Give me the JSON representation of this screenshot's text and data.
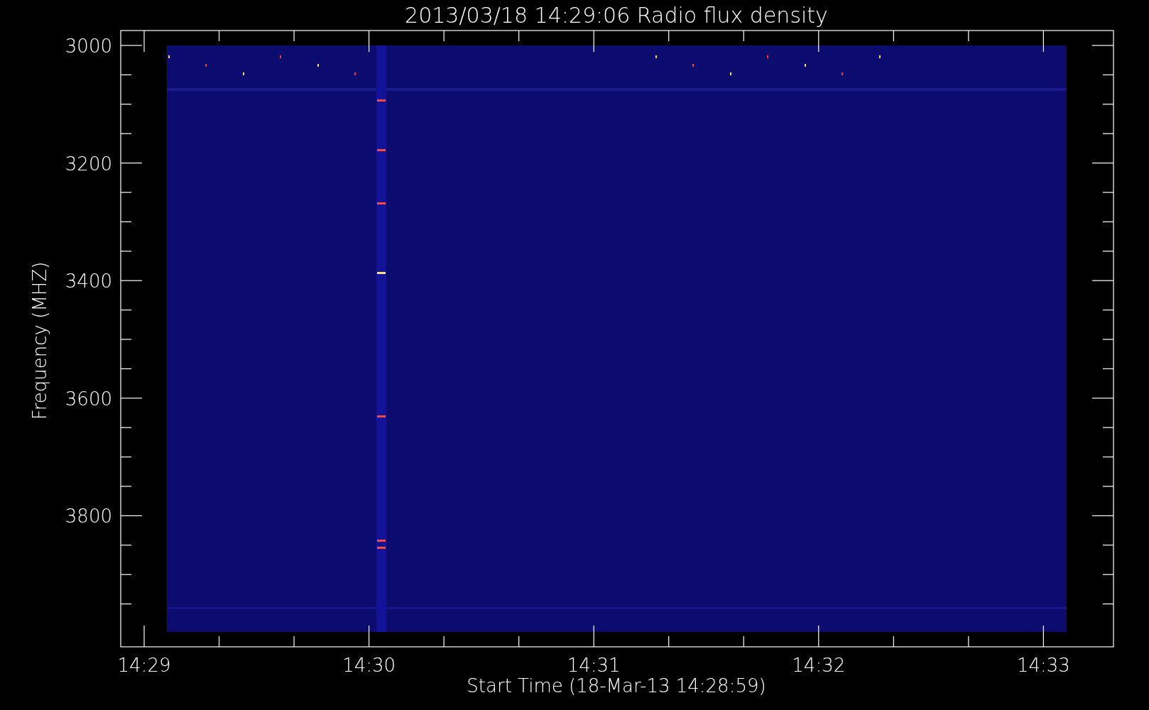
{
  "plot": {
    "title": "2013/03/18 14:29:06 Radio flux density",
    "ylabel": "Frequency (MHZ)",
    "xlabel": "Start Time (18-Mar-13 14:28:59)",
    "ytick_labels": [
      "3000",
      "3200",
      "3400",
      "3600",
      "3800"
    ],
    "xtick_labels": [
      "14:29",
      "14:30",
      "14:31",
      "14:32",
      "14:33"
    ]
  }
}
